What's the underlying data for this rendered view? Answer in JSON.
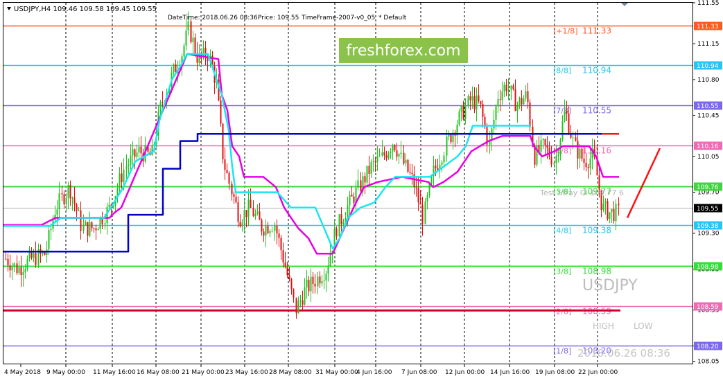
{
  "header": {
    "symbol_info": "USDJPY,H4  109.46 109.58 109.45 109.55",
    "datetime": "DateTime: 2018.06.26 08:36",
    "price": "Price: 109.55",
    "timeframe": "TimeFrame-2007-v0_05",
    "mode": "*   Default"
  },
  "watermark": {
    "text": "freshforex.com",
    "bg_color": "#8bc34a"
  },
  "overlay": {
    "symbol": "USDJPY",
    "high_label": "HIGH",
    "low_label": "LOW",
    "timestamp": "2018.06.26 08:36",
    "faded_text": "Test Stray Cl 109.77 6"
  },
  "chart_data": {
    "type": "candlestick",
    "symbol": "USDJPY",
    "timeframe": "H4",
    "ylim": [
      108.02,
      111.55
    ],
    "y_ticks": [
      "111.55",
      "111.15",
      "110.80",
      "110.45",
      "110.05",
      "109.70",
      "109.30",
      "108.95",
      "108.55",
      "108.20",
      "108.05"
    ],
    "x_ticks": [
      "4 May 2018",
      "9 May 00:00",
      "11 May 16:00",
      "16 May 08:00",
      "21 May 00:00",
      "23 May 16:00",
      "28 May 08:00",
      "31 May 00:00",
      "4 Jun 16:00",
      "7 Jun 08:00",
      "12 Jun 00:00",
      "14 Jun 16:00",
      "19 Jun 08:00",
      "22 Jun 00:00"
    ],
    "current_price": "109.55",
    "current_price_value": 109.55,
    "murrey_levels": [
      {
        "label": "[+1/8]",
        "value": "111.33",
        "price": 111.33,
        "color": "#ff5a1f"
      },
      {
        "label": "[8/8]",
        "value": "110.94",
        "price": 110.94,
        "color": "#29c5f6"
      },
      {
        "label": "[7/8]",
        "value": "110.55",
        "price": 110.55,
        "color": "#7b68ee"
      },
      {
        "label": "[6/8]",
        "value": "110.16",
        "price": 110.16,
        "color": "#f06ab4"
      },
      {
        "label": "[5/8]",
        "value": "109.77",
        "price": 109.76,
        "color": "#3fd63f"
      },
      {
        "label": "[4/8]",
        "value": "109.38",
        "price": 109.38,
        "color": "#29c5f6"
      },
      {
        "label": "[3/8]",
        "value": "108.98",
        "price": 108.98,
        "color": "#33e033"
      },
      {
        "label": "[2/8]",
        "value": "108.59",
        "price": 108.59,
        "color": "#f06ab4"
      },
      {
        "label": "[1/8]",
        "value": "108.20",
        "price": 108.2,
        "color": "#7b68ee"
      }
    ],
    "level_price_tags": [
      "111.33",
      "110.94",
      "110.55",
      "110.16",
      "109.76",
      "109.38",
      "108.98",
      "108.59",
      "108.20"
    ],
    "candle_colors": {
      "up": "#22c322",
      "down": "#e01010"
    },
    "line_colors": {
      "blue": "#0000c8",
      "cyan": "#19e6f0",
      "magenta": "#e600e6",
      "arrow": "#ff1010"
    }
  }
}
